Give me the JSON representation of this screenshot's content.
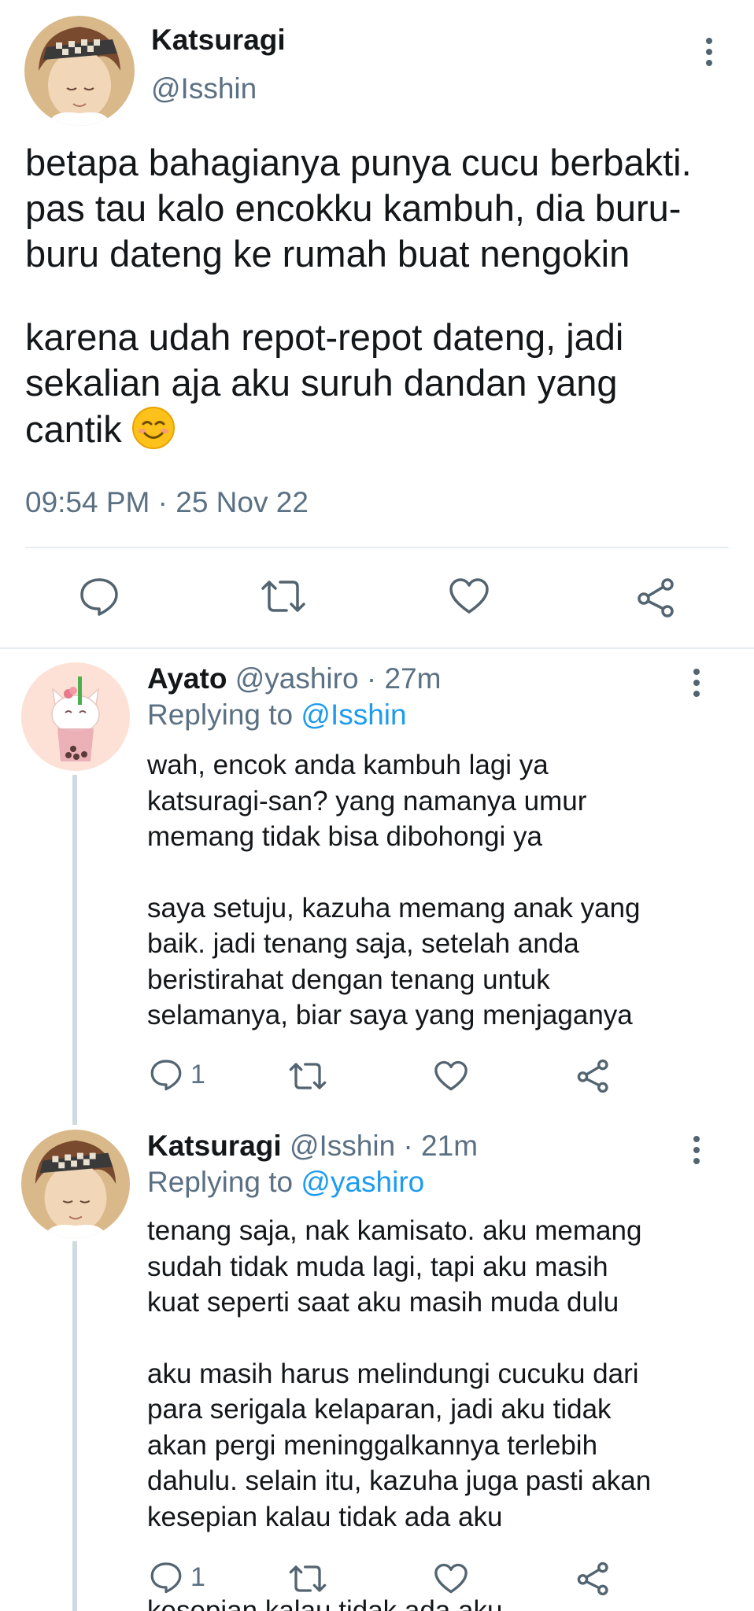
{
  "main_tweet": {
    "author_name": "Katsuragi",
    "author_handle": "@Isshin",
    "paragraphs": [
      [
        "betapa bahagianya punya cucu berbakti.",
        "pas tau kalo encokku kambuh, dia buru-",
        "buru dateng ke rumah buat nengokin"
      ],
      [
        "karena udah repot-repot dateng, jadi",
        "sekalian aja aku suruh dandan yang",
        "cantik"
      ]
    ],
    "emoji": "smiling-face-emoji",
    "timestamp": "09:54 PM · 25 Nov 22",
    "actions": [
      "reply-icon",
      "retweet-icon",
      "like-icon",
      "share-icon"
    ]
  },
  "replies": [
    {
      "author_name": "Ayato",
      "author_handle": "@yashiro",
      "meta": " · 27m",
      "replying_prefix": "Replying to ",
      "replying_to": "@Isshin",
      "paragraphs": [
        [
          "wah, encok anda kambuh lagi ya",
          "katsuragi-san? yang namanya umur",
          "memang tidak bisa dibohongi ya"
        ],
        [
          "saya setuju, kazuha memang anak yang",
          "baik. jadi tenang saja, setelah anda",
          "beristirahat dengan tenang untuk",
          "selamanya, biar saya yang menjaganya"
        ]
      ],
      "reply_count": "1"
    },
    {
      "author_name": "Katsuragi",
      "author_handle": "@Isshin",
      "meta": " · 21m",
      "replying_prefix": "Replying to ",
      "replying_to": "@yashiro",
      "paragraphs": [
        [
          "tenang saja, nak kamisato. aku memang",
          "sudah tidak muda lagi, tapi aku masih",
          "kuat seperti saat aku masih muda dulu"
        ],
        [
          "aku masih harus melindungi cucuku dari",
          "para serigala kelaparan, jadi aku tidak",
          "akan pergi meninggalkannya terlebih",
          "dahulu. selain itu, kazuha juga pasti akan",
          "kesepian kalau tidak ada aku"
        ]
      ],
      "reply_count": "1"
    }
  ],
  "cut_off_text": "kesepian kalau tidak ada aku",
  "colors": {
    "text": "#14171a",
    "secondary": "#5b7083",
    "mention": "#1d9bf0",
    "divider": "#e6ecf0",
    "thread_line": "#cfd9de"
  }
}
